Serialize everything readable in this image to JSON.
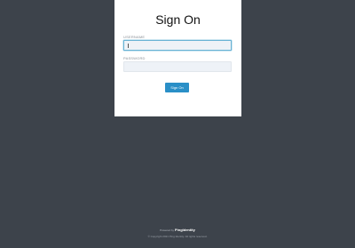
{
  "signon": {
    "title": "Sign On",
    "username_label": "USERNAME",
    "username_value": "",
    "password_label": "PASSWORD",
    "password_value": "",
    "submit_label": "Sign On"
  },
  "footer": {
    "powered_by": "Powered by",
    "brand": "PingIdentity",
    "copyright": "© Copyright 2021 Ping Identity. All rights reserved."
  },
  "colors": {
    "background": "#3d434b",
    "card": "#ffffff",
    "button": "#2a8fc7",
    "focus_border": "#68b2d4"
  }
}
